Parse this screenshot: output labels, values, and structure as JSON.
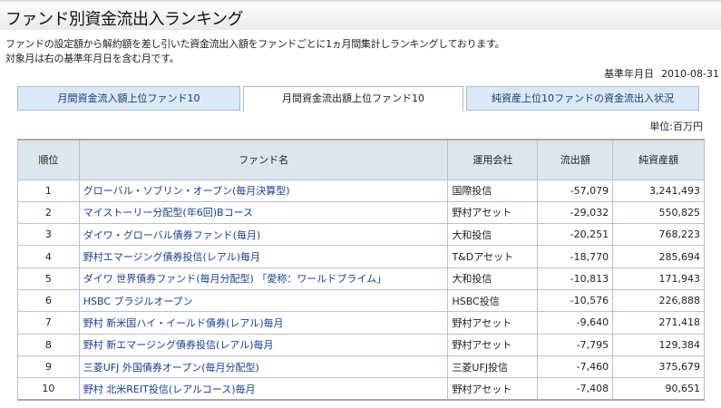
{
  "title": "ファンド別資金流出入ランキング",
  "description": [
    "ファンドの設定額から解約額を差し引いた資金流出入額をファンドごとに1ヵ月間集計しランキングしております。",
    "対象月は右の基準年月日を含む月です。"
  ],
  "base_date_label": "基準年月日",
  "base_date": "2010-08-31",
  "tabs": [
    {
      "label": "月間資金流入額上位ファンド10"
    },
    {
      "label": "月間資金流出額上位ファンド10"
    },
    {
      "label": "純資産上位10ファンドの資金流出入状況"
    }
  ],
  "unit": "単位:百万円",
  "columns": [
    "順位",
    "ファンド名",
    "運用会社",
    "流出額",
    "純資産額"
  ],
  "rows": [
    [
      "1",
      "グローバル・ソブリン・オープン(毎月決算型)",
      "国際投信",
      "-57,079",
      "3,241,493"
    ],
    [
      "2",
      "マイストーリー分配型(年6回)Bコース",
      "野村アセット",
      "-29,032",
      "550,825"
    ],
    [
      "3",
      "ダイワ・グローバル債券ファンド(毎月)",
      "大和投信",
      "-20,251",
      "768,223"
    ],
    [
      "4",
      "野村エマージング債券投信(レアル)毎月",
      "T&Dアセット",
      "-18,770",
      "285,694"
    ],
    [
      "5",
      "ダイワ 世界債券ファンド(毎月分配型) 「愛称：ワールドプライム」",
      "大和投信",
      "-10,813",
      "171,943"
    ],
    [
      "6",
      "HSBC ブラジルオープン",
      "HSBC投信",
      "-10,576",
      "226,888"
    ],
    [
      "7",
      "野村 新米国ハイ・イールド債券(レアル)毎月",
      "野村アセット",
      "-9,640",
      "271,418"
    ],
    [
      "8",
      "野村 新エマージング債券投信(レアル)毎月",
      "野村アセット",
      "-7,795",
      "129,384"
    ],
    [
      "9",
      "三菱UFJ 外国債券オープン(毎月分配型)",
      "三菱UFJ投信",
      "-7,460",
      "375,679"
    ],
    [
      "10",
      "野村 北米REIT投信(レアルコース)毎月",
      "野村アセット",
      "-7,408",
      "90,651"
    ]
  ]
}
